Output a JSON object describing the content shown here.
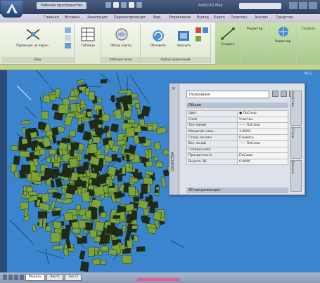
{
  "window": {
    "doc_tab_label": "Рабочее пространство",
    "title_text": "AutoCAD Map"
  },
  "menubar": {
    "tabs": [
      "Главная",
      "Вставка",
      "Аннотации",
      "Параметризация",
      "Вид",
      "Управление",
      "Вывод",
      "Карта",
      "Подключ.",
      "Анализ",
      "Средства"
    ]
  },
  "ribbon": {
    "panels": [
      {
        "title": "Вид",
        "buttons": [
          "Проекция на экран",
          "Таблица"
        ]
      },
      {
        "title": "Рабочие окна",
        "buttons": [
          "Обзор карты"
        ]
      },
      {
        "title": "Набор изменений",
        "buttons": [
          "Обновить",
          "Вернуть"
        ]
      },
      {
        "title": "",
        "buttons": [
          "Создать"
        ]
      },
      {
        "title": "",
        "buttons": [
          "Редактир."
        ]
      },
      {
        "title": "",
        "buttons": [
          "Редактир."
        ]
      },
      {
        "title": "",
        "buttons": [
          "Создать"
        ]
      }
    ]
  },
  "drawing": {
    "coord_readout": "WCS"
  },
  "palette": {
    "object_select": "Полилиния",
    "section_general": "Общие",
    "section_geometry": "3D-визуализация",
    "strip_label": "СВОЙСТВА",
    "tabs": [
      "Свойства",
      "Стили",
      "Данные"
    ],
    "rows": [
      {
        "key": "Цвет",
        "value": "● ПоСлою"
      },
      {
        "key": "Слой",
        "value": "Участки"
      },
      {
        "key": "Тип линий",
        "value": "—— ПоСлою"
      },
      {
        "key": "Масштаб типа...",
        "value": "1.0000"
      },
      {
        "key": "Стиль печати",
        "value": "ПоЦвету"
      },
      {
        "key": "Вес линий",
        "value": "—— ПоСлою"
      },
      {
        "key": "Гиперссылка",
        "value": ""
      },
      {
        "key": "Прозрачность",
        "value": "ПоСлою"
      },
      {
        "key": "Высота 3D",
        "value": "0.0000"
      }
    ]
  },
  "bottom": {
    "tabs": [
      "Модель",
      "Лист1",
      "Лист2"
    ]
  },
  "colors": {
    "canvas": "#3b85cf",
    "parcels": "#7ca43a",
    "ribbon": "#dfe8d3"
  }
}
